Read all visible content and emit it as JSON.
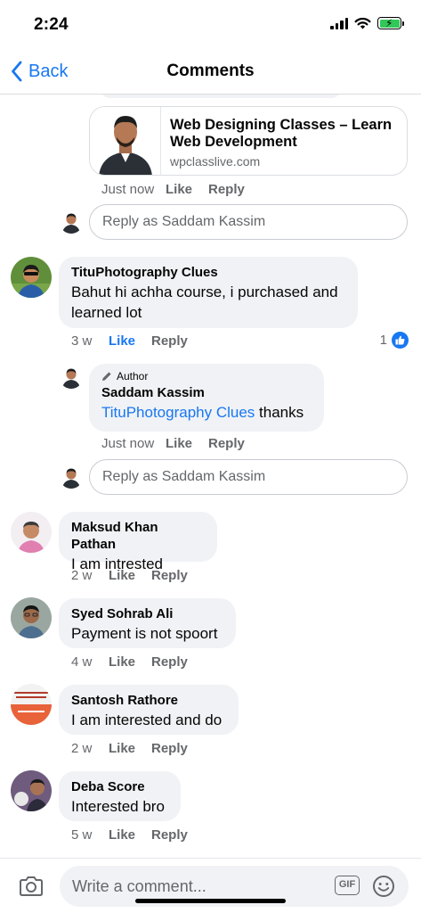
{
  "status_bar": {
    "time": "2:24"
  },
  "nav": {
    "back_label": "Back",
    "title": "Comments"
  },
  "link_preview": {
    "title": "Web Designing Classes – Learn Web Development",
    "domain": "wpclasslive.com",
    "time": "Just now",
    "like": "Like",
    "reply": "Reply"
  },
  "reply_inputs": [
    {
      "placeholder": "Reply as Saddam Kassim"
    },
    {
      "placeholder": "Reply as Saddam Kassim"
    }
  ],
  "comments": [
    {
      "name": "TituPhotography Clues",
      "text": "Bahut hi achha course, i purchased and learned lot",
      "time": "3 w",
      "like": "Like",
      "reply": "Reply",
      "like_count": "1",
      "reply_item": {
        "author_tag": "Author",
        "name": "Saddam Kassim",
        "mention": "TituPhotography Clues",
        "text": " thanks",
        "time": "Just now",
        "like": "Like",
        "reply": "Reply"
      }
    },
    {
      "name": "Maksud Khan Pathan",
      "text": "I am intrested",
      "time": "2 w",
      "like": "Like",
      "reply": "Reply"
    },
    {
      "name": "Syed Sohrab Ali",
      "text": "Payment is not spoort",
      "time": "4 w",
      "like": "Like",
      "reply": "Reply"
    },
    {
      "name": "Santosh Rathore",
      "text": "I am interested and do",
      "time": "2 w",
      "like": "Like",
      "reply": "Reply"
    },
    {
      "name": "Deba Score",
      "text": "Interested bro",
      "time": "5 w",
      "like": "Like",
      "reply": "Reply"
    }
  ],
  "composer": {
    "placeholder": "Write a comment...",
    "gif_label": "GIF"
  },
  "colors": {
    "accent": "#1877f2",
    "bubble": "#f0f2f5",
    "secondary_text": "#65676b"
  }
}
